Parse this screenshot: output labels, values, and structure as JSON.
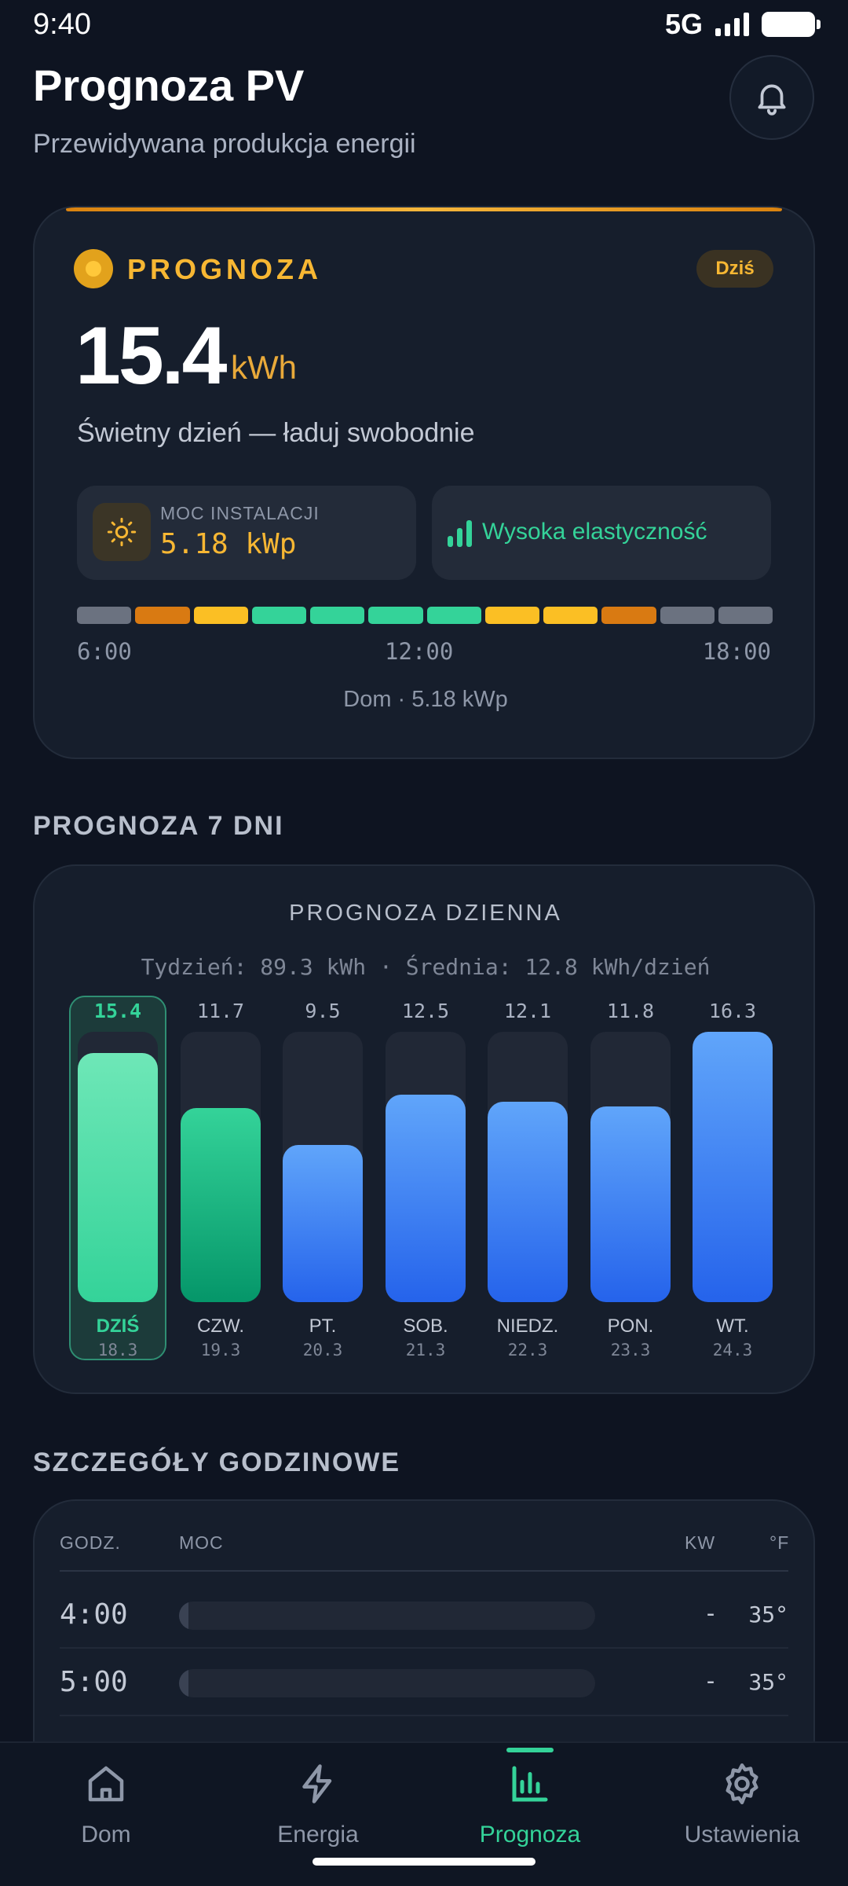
{
  "status_bar": {
    "time": "9:40",
    "network": "5G"
  },
  "header": {
    "title": "Prognoza PV",
    "subtitle": "Przewidywana produkcja energii",
    "bell_icon": "bell-icon"
  },
  "forecast": {
    "label": "PROGNOZA",
    "badge": "Dziś",
    "value": "15.4",
    "unit": "kWh",
    "tagline": "Świetny dzień — ładuj swobodnie",
    "installation_label": "MOC INSTALACJI",
    "installation_value": "5.18 kWp",
    "flexibility": "Wysoka elastyczność",
    "timeline_colors": [
      "#6b7280",
      "#d97a12",
      "#fbbf24",
      "#34d399",
      "#34d399",
      "#34d399",
      "#34d399",
      "#fbbf24",
      "#fbbf24",
      "#d97a12",
      "#6b7280",
      "#6b7280"
    ],
    "timeline_labels": [
      "6:00",
      "12:00",
      "18:00"
    ],
    "footer": "Dom · 5.18 kWp"
  },
  "week_section": {
    "title": "PROGNOZA 7 DNI",
    "chart_title": "PROGNOZA DZIENNA",
    "summary": "Tydzień: 89.3 kWh · Średnia: 12.8 kWh/dzień"
  },
  "chart_data": {
    "type": "bar",
    "title": "PROGNOZA DZIENNA",
    "categories": [
      "DZIŚ",
      "CZW.",
      "PT.",
      "SOB.",
      "NIEDZ.",
      "PON.",
      "WT."
    ],
    "dates": [
      "18.3",
      "19.3",
      "20.3",
      "21.3",
      "22.3",
      "23.3",
      "24.3"
    ],
    "values": [
      15.4,
      11.7,
      9.5,
      12.5,
      12.1,
      11.8,
      16.3
    ],
    "value_labels": [
      "15.4",
      "11.7",
      "9.5",
      "12.5",
      "12.1",
      "11.8",
      "16.3"
    ],
    "colors": [
      "#34d399",
      "#10b981",
      "#3b82f6",
      "#3b82f6",
      "#3b82f6",
      "#3b82f6",
      "#3b82f6"
    ],
    "ylim": [
      0,
      16.3
    ]
  },
  "hourly": {
    "title": "SZCZEGÓŁY GODZINOWE",
    "columns": {
      "hour": "GODZ.",
      "power": "MOC",
      "kw": "KW",
      "temp": "°F"
    },
    "rows": [
      {
        "time": "4:00",
        "kw": "-",
        "temp": "35°"
      },
      {
        "time": "5:00",
        "kw": "-",
        "temp": "35°"
      }
    ]
  },
  "nav": {
    "items": [
      {
        "label": "Dom",
        "icon": "home-icon"
      },
      {
        "label": "Energia",
        "icon": "bolt-icon"
      },
      {
        "label": "Prognoza",
        "icon": "chart-icon"
      },
      {
        "label": "Ustawienia",
        "icon": "gear-icon"
      }
    ],
    "active": 2
  }
}
